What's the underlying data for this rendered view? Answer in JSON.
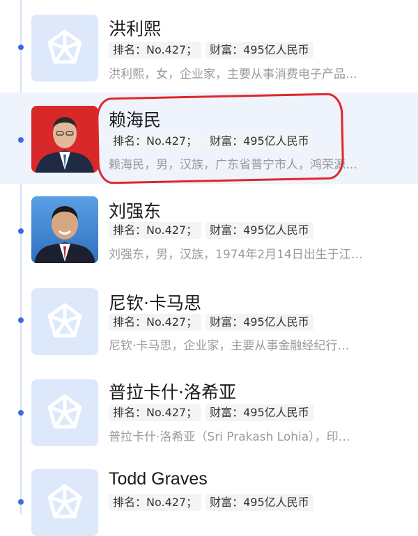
{
  "colors": {
    "accent": "#3d6be8",
    "highlight_bg": "#eef3fc",
    "annotation_red": "#e0262b",
    "placeholder_bg": "#dde8fb"
  },
  "items": [
    {
      "name": "洪利熙",
      "rank": "排名：No.427；",
      "wealth": "财富：495亿人民币",
      "desc": "洪利熙，女，企业家，主要从事消费电子产品…",
      "avatar": "placeholder-icon"
    },
    {
      "name": "赖海民",
      "rank": "排名：No.427；",
      "wealth": "财富：495亿人民币",
      "desc": "赖海民，男，汉族，广东省普宁市人，鸿荣源…",
      "avatar": "portrait-photo-red-bg"
    },
    {
      "name": "刘强东",
      "rank": "排名：No.427；",
      "wealth": "财富：495亿人民币",
      "desc": "刘强东，男，汉族，1974年2月14日出生于江…",
      "avatar": "portrait-photo-blue-bg"
    },
    {
      "name": "尼钦·卡马思",
      "rank": "排名：No.427；",
      "wealth": "财富：495亿人民币",
      "desc": "尼钦·卡马思，企业家，主要从事金融经纪行…",
      "avatar": "placeholder-icon"
    },
    {
      "name": "普拉卡什·洛希亚",
      "rank": "排名：No.427；",
      "wealth": "财富：495亿人民币",
      "desc": "普拉卡什·洛希亚（Sri Prakash Lohia），印…",
      "avatar": "placeholder-icon"
    },
    {
      "name": "Todd Graves",
      "rank": "排名：No.427；",
      "wealth": "财富：495亿人民币",
      "desc": "",
      "avatar": "placeholder-icon"
    }
  ]
}
